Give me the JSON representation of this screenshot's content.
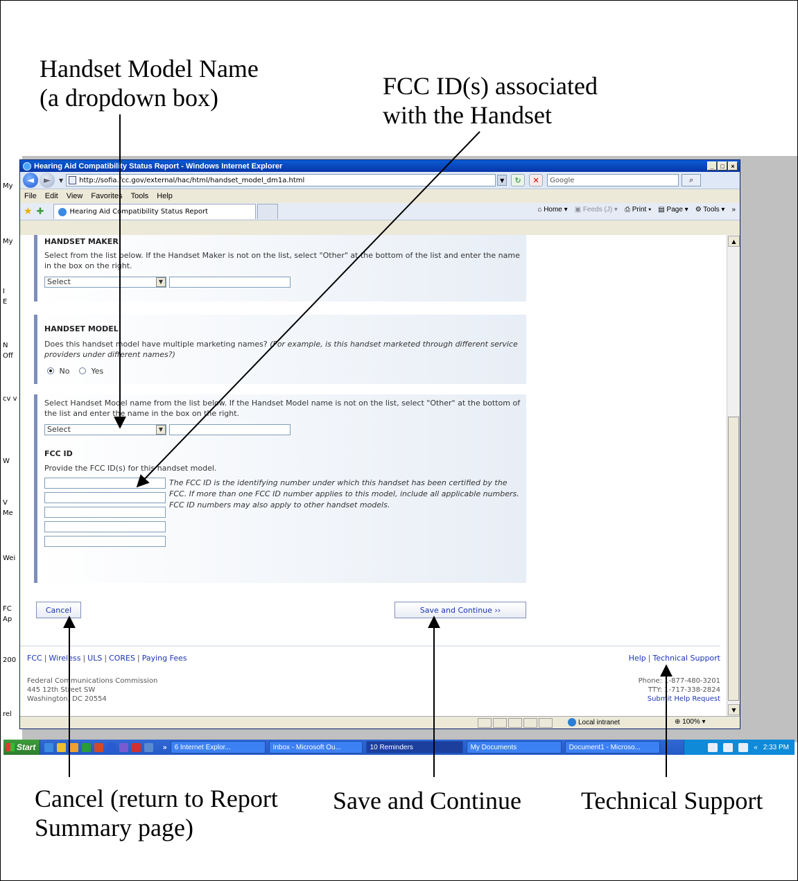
{
  "annotations": {
    "handset_model_name": "Handset Model Name\n(a dropdown box)",
    "fcc_ids": "FCC ID(s) associated\nwith the Handset",
    "cancel": "Cancel (return to Report\nSummary page)",
    "save_continue": "Save and Continue",
    "tech_support": "Technical Support"
  },
  "desktop": {
    "labels": [
      "My",
      "My",
      "I",
      "E",
      "N",
      "Off",
      "cv v",
      "W",
      "V",
      "Me",
      "Wei",
      "FC",
      "Ap",
      "200",
      "rel"
    ]
  },
  "browser": {
    "window_title": "Hearing Aid Compatibility Status Report - Windows Internet Explorer",
    "url": "http://sofia.fcc.gov/external/hac/html/handset_model_dm1a.html",
    "search_placeholder": "Google",
    "menu": [
      "File",
      "Edit",
      "View",
      "Favorites",
      "Tools",
      "Help"
    ],
    "tab_title": "Hearing Aid Compatibility Status Report",
    "commands": {
      "home": "Home",
      "feeds": "Feeds (J)",
      "print": "Print",
      "page": "Page",
      "tools": "Tools",
      "more": "»"
    },
    "status": {
      "zone": "Local intranet",
      "zoom": "100%"
    }
  },
  "form": {
    "maker": {
      "title": "HANDSET MAKER",
      "help": "Select from the list below. If the Handset Maker is not on the list, select \"Other\" at the bottom of the list and enter the name in the box on the right.",
      "select_value": "Select"
    },
    "model": {
      "title": "HANDSET MODEL",
      "question": "Does this handset model have multiple marketing names?",
      "question_note": "(For example, is this handset marketed through different service providers under different names?)",
      "radio_no": "No",
      "radio_yes": "Yes",
      "selected": "No"
    },
    "model_name": {
      "help": "Select Handset Model name from the list below. If the Handset Model name is not on the list, select \"Other\" at the bottom of the list and enter the name in the box on the right.",
      "select_value": "Select"
    },
    "fcc": {
      "title": "FCC ID",
      "help": "Provide the FCC ID(s) for this handset model.",
      "note": "The FCC ID is the identifying number under which this handset has been certified by the FCC. If more than one FCC ID number applies to this model, include all applicable numbers. FCC ID numbers may also apply to other handset models.",
      "inputs": [
        "",
        "",
        "",
        "",
        ""
      ]
    },
    "buttons": {
      "cancel": "Cancel",
      "save": "Save and Continue ››"
    }
  },
  "footer": {
    "links": [
      "FCC",
      "Wireless",
      "ULS",
      "CORES",
      "Paying Fees"
    ],
    "help_links": [
      "Help",
      "Technical Support"
    ],
    "address": [
      "Federal Communications Commission",
      "445 12th Street SW",
      "Washington, DC 20554"
    ],
    "phone": "Phone: 1-877-480-3201",
    "tty": "TTY: 1-717-338-2824",
    "submit": "Submit Help Request"
  },
  "taskbar": {
    "start": "Start",
    "more": "»",
    "items": [
      "6 Internet Explor...",
      "Inbox - Microsoft Ou...",
      "10 Reminders",
      "My Documents",
      "Document1 - Microso..."
    ],
    "clock_more": "«",
    "clock": "2:33 PM"
  }
}
